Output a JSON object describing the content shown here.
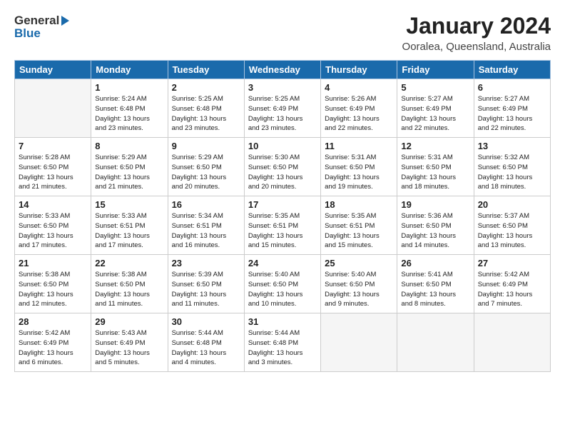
{
  "header": {
    "logo_general": "General",
    "logo_blue": "Blue",
    "month_year": "January 2024",
    "location": "Ooralea, Queensland, Australia"
  },
  "weekdays": [
    "Sunday",
    "Monday",
    "Tuesday",
    "Wednesday",
    "Thursday",
    "Friday",
    "Saturday"
  ],
  "weeks": [
    [
      {
        "day": "",
        "text": ""
      },
      {
        "day": "1",
        "text": "Sunrise: 5:24 AM\nSunset: 6:48 PM\nDaylight: 13 hours\nand 23 minutes."
      },
      {
        "day": "2",
        "text": "Sunrise: 5:25 AM\nSunset: 6:48 PM\nDaylight: 13 hours\nand 23 minutes."
      },
      {
        "day": "3",
        "text": "Sunrise: 5:25 AM\nSunset: 6:49 PM\nDaylight: 13 hours\nand 23 minutes."
      },
      {
        "day": "4",
        "text": "Sunrise: 5:26 AM\nSunset: 6:49 PM\nDaylight: 13 hours\nand 22 minutes."
      },
      {
        "day": "5",
        "text": "Sunrise: 5:27 AM\nSunset: 6:49 PM\nDaylight: 13 hours\nand 22 minutes."
      },
      {
        "day": "6",
        "text": "Sunrise: 5:27 AM\nSunset: 6:49 PM\nDaylight: 13 hours\nand 22 minutes."
      }
    ],
    [
      {
        "day": "7",
        "text": "Sunrise: 5:28 AM\nSunset: 6:50 PM\nDaylight: 13 hours\nand 21 minutes."
      },
      {
        "day": "8",
        "text": "Sunrise: 5:29 AM\nSunset: 6:50 PM\nDaylight: 13 hours\nand 21 minutes."
      },
      {
        "day": "9",
        "text": "Sunrise: 5:29 AM\nSunset: 6:50 PM\nDaylight: 13 hours\nand 20 minutes."
      },
      {
        "day": "10",
        "text": "Sunrise: 5:30 AM\nSunset: 6:50 PM\nDaylight: 13 hours\nand 20 minutes."
      },
      {
        "day": "11",
        "text": "Sunrise: 5:31 AM\nSunset: 6:50 PM\nDaylight: 13 hours\nand 19 minutes."
      },
      {
        "day": "12",
        "text": "Sunrise: 5:31 AM\nSunset: 6:50 PM\nDaylight: 13 hours\nand 18 minutes."
      },
      {
        "day": "13",
        "text": "Sunrise: 5:32 AM\nSunset: 6:50 PM\nDaylight: 13 hours\nand 18 minutes."
      }
    ],
    [
      {
        "day": "14",
        "text": "Sunrise: 5:33 AM\nSunset: 6:50 PM\nDaylight: 13 hours\nand 17 minutes."
      },
      {
        "day": "15",
        "text": "Sunrise: 5:33 AM\nSunset: 6:51 PM\nDaylight: 13 hours\nand 17 minutes."
      },
      {
        "day": "16",
        "text": "Sunrise: 5:34 AM\nSunset: 6:51 PM\nDaylight: 13 hours\nand 16 minutes."
      },
      {
        "day": "17",
        "text": "Sunrise: 5:35 AM\nSunset: 6:51 PM\nDaylight: 13 hours\nand 15 minutes."
      },
      {
        "day": "18",
        "text": "Sunrise: 5:35 AM\nSunset: 6:51 PM\nDaylight: 13 hours\nand 15 minutes."
      },
      {
        "day": "19",
        "text": "Sunrise: 5:36 AM\nSunset: 6:50 PM\nDaylight: 13 hours\nand 14 minutes."
      },
      {
        "day": "20",
        "text": "Sunrise: 5:37 AM\nSunset: 6:50 PM\nDaylight: 13 hours\nand 13 minutes."
      }
    ],
    [
      {
        "day": "21",
        "text": "Sunrise: 5:38 AM\nSunset: 6:50 PM\nDaylight: 13 hours\nand 12 minutes."
      },
      {
        "day": "22",
        "text": "Sunrise: 5:38 AM\nSunset: 6:50 PM\nDaylight: 13 hours\nand 11 minutes."
      },
      {
        "day": "23",
        "text": "Sunrise: 5:39 AM\nSunset: 6:50 PM\nDaylight: 13 hours\nand 11 minutes."
      },
      {
        "day": "24",
        "text": "Sunrise: 5:40 AM\nSunset: 6:50 PM\nDaylight: 13 hours\nand 10 minutes."
      },
      {
        "day": "25",
        "text": "Sunrise: 5:40 AM\nSunset: 6:50 PM\nDaylight: 13 hours\nand 9 minutes."
      },
      {
        "day": "26",
        "text": "Sunrise: 5:41 AM\nSunset: 6:50 PM\nDaylight: 13 hours\nand 8 minutes."
      },
      {
        "day": "27",
        "text": "Sunrise: 5:42 AM\nSunset: 6:49 PM\nDaylight: 13 hours\nand 7 minutes."
      }
    ],
    [
      {
        "day": "28",
        "text": "Sunrise: 5:42 AM\nSunset: 6:49 PM\nDaylight: 13 hours\nand 6 minutes."
      },
      {
        "day": "29",
        "text": "Sunrise: 5:43 AM\nSunset: 6:49 PM\nDaylight: 13 hours\nand 5 minutes."
      },
      {
        "day": "30",
        "text": "Sunrise: 5:44 AM\nSunset: 6:48 PM\nDaylight: 13 hours\nand 4 minutes."
      },
      {
        "day": "31",
        "text": "Sunrise: 5:44 AM\nSunset: 6:48 PM\nDaylight: 13 hours\nand 3 minutes."
      },
      {
        "day": "",
        "text": ""
      },
      {
        "day": "",
        "text": ""
      },
      {
        "day": "",
        "text": ""
      }
    ]
  ]
}
